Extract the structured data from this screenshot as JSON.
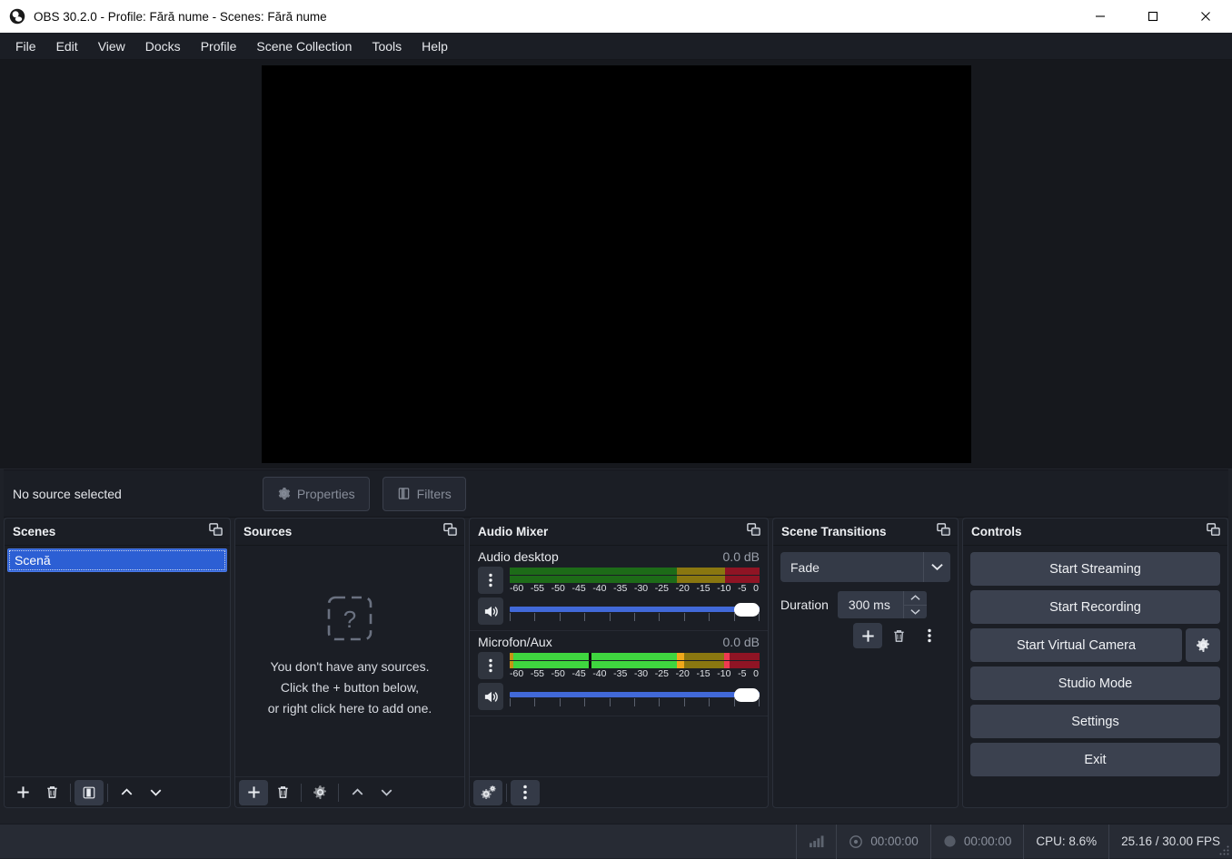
{
  "window": {
    "title": "OBS 30.2.0 - Profile: Fără nume - Scenes: Fără nume",
    "logo_icon": "obs-logo-icon",
    "minimize_icon": "minimize-icon",
    "maximize_icon": "maximize-icon",
    "close_icon": "close-icon"
  },
  "menubar": {
    "items": [
      {
        "label": "File"
      },
      {
        "label": "Edit"
      },
      {
        "label": "View"
      },
      {
        "label": "Docks"
      },
      {
        "label": "Profile"
      },
      {
        "label": "Scene Collection"
      },
      {
        "label": "Tools"
      },
      {
        "label": "Help"
      }
    ]
  },
  "preview": {
    "canvas_color": "#000000",
    "background_color": "#16181d"
  },
  "source_toolbar": {
    "status": "No source selected",
    "properties_label": "Properties",
    "properties_icon": "gear-icon",
    "filters_label": "Filters",
    "filters_icon": "filters-icon"
  },
  "scenes": {
    "title": "Scenes",
    "float_icon": "float-dock-icon",
    "items": [
      {
        "name": "Scenă",
        "selected": true
      }
    ],
    "toolbar": [
      {
        "icon": "plus-icon",
        "name": "add-scene-button"
      },
      {
        "icon": "trash-icon",
        "name": "remove-scene-button"
      },
      {
        "icon": "filters-icon",
        "name": "scene-filters-button"
      },
      {
        "icon": "chevron-up-icon",
        "name": "move-scene-up-button"
      },
      {
        "icon": "chevron-down-icon",
        "name": "move-scene-down-button"
      }
    ]
  },
  "sources": {
    "title": "Sources",
    "float_icon": "float-dock-icon",
    "empty_icon": "question-box-icon",
    "empty_line1": "You don't have any sources.",
    "empty_line2": "Click the + button below,",
    "empty_line3": "or right click here to add one.",
    "toolbar": [
      {
        "icon": "plus-icon",
        "name": "add-source-button"
      },
      {
        "icon": "trash-icon",
        "name": "remove-source-button"
      },
      {
        "icon": "gear-icon",
        "name": "source-properties-button"
      },
      {
        "icon": "chevron-up-icon",
        "name": "move-source-up-button"
      },
      {
        "icon": "chevron-down-icon",
        "name": "move-source-down-button"
      }
    ]
  },
  "mixer": {
    "title": "Audio Mixer",
    "float_icon": "float-dock-icon",
    "tick_labels": [
      "-60",
      "-55",
      "-50",
      "-45",
      "-40",
      "-35",
      "-30",
      "-25",
      "-20",
      "-15",
      "-10",
      "-5",
      "0"
    ],
    "channels": [
      {
        "name": "Audio desktop",
        "db": "0.0 dB",
        "active": false,
        "menu_icon": "vertical-dots-icon",
        "speaker_icon": "speaker-on-icon",
        "volume_percent": 100
      },
      {
        "name": "Microfon/Aux",
        "db": "0.0 dB",
        "active": true,
        "level_percent": 67,
        "peak_percent": 86,
        "menu_icon": "vertical-dots-icon",
        "speaker_icon": "speaker-on-icon",
        "volume_percent": 100
      }
    ],
    "toolbar": [
      {
        "icon": "advanced-audio-icon",
        "name": "advanced-audio-properties-button"
      },
      {
        "icon": "vertical-dots-icon",
        "name": "mixer-menu-button"
      }
    ]
  },
  "transitions": {
    "title": "Scene Transitions",
    "float_icon": "float-dock-icon",
    "selected": "Fade",
    "dropdown_icon": "chevron-down-icon",
    "duration_label": "Duration",
    "duration_value": "300 ms",
    "toolbar": [
      {
        "icon": "plus-icon",
        "name": "add-transition-button"
      },
      {
        "icon": "trash-icon",
        "name": "remove-transition-button"
      },
      {
        "icon": "vertical-dots-icon",
        "name": "transition-menu-button"
      }
    ]
  },
  "controls": {
    "title": "Controls",
    "float_icon": "float-dock-icon",
    "start_streaming": "Start Streaming",
    "start_recording": "Start Recording",
    "start_virtual_camera": "Start Virtual Camera",
    "virtual_camera_config_icon": "gear-icon",
    "studio_mode": "Studio Mode",
    "settings": "Settings",
    "exit": "Exit"
  },
  "statusbar": {
    "signal_icon": "signal-bars-icon",
    "stream_icon": "broadcast-icon",
    "stream_time": "00:00:00",
    "record_icon": "record-dot-icon",
    "record_time": "00:00:00",
    "cpu": "CPU: 8.6%",
    "fps": "25.16 / 30.00 FPS",
    "grip_icon": "resize-grip-icon"
  }
}
